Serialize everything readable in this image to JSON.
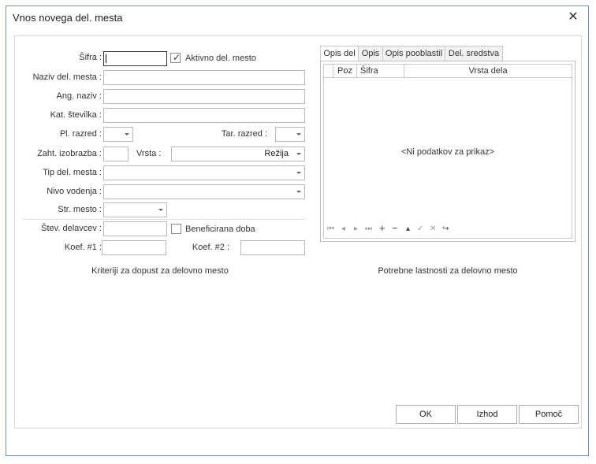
{
  "window": {
    "title": "Vnos novega del. mesta"
  },
  "form": {
    "sifra_label": "Šifra :",
    "aktivno_label": "Aktivno del. mesto",
    "aktivno_checked": true,
    "naziv_label": "Naziv del. mesta :",
    "ang_naziv_label": "Ang. naziv :",
    "kat_stevilka_label": "Kat. številka :",
    "pl_razred_label": "Pl. razred :",
    "tar_razred_label": "Tar. razred :",
    "zaht_izobrazba_label": "Zaht. izobrazba :",
    "vrsta_label": "Vrsta :",
    "vrsta_value": "Režija",
    "tip_label": "Tip del. mesta :",
    "nivo_label": "Nivo vodenja :",
    "str_mesto_label": "Str. mesto :",
    "stev_delavcev_label": "Štev. delavcev :",
    "beneficirana_label": "Beneficirana doba",
    "beneficirana_checked": false,
    "koef1_label": "Koef. #1 :",
    "koef2_label": "Koef. #2 :"
  },
  "captions": {
    "left": "Kriteriji za dopust za delovno mesto",
    "right": "Potrebne lastnosti za delovno mesto"
  },
  "tabs": [
    {
      "label": "Opis del",
      "active": true
    },
    {
      "label": "Opis"
    },
    {
      "label": "Opis pooblastil"
    },
    {
      "label": "Del. sredstva"
    }
  ],
  "grid": {
    "columns": [
      "Poz",
      "Šifra",
      "Vrsta dela"
    ],
    "empty_text": "<Ni podatkov za prikaz>"
  },
  "navigator": [
    "first-icon",
    "prev-icon",
    "next-icon",
    "last-icon",
    "add-icon",
    "delete-icon",
    "up-icon",
    "confirm-icon",
    "cancel-icon",
    "refresh-icon"
  ],
  "buttons": {
    "ok": "OK",
    "izhod": "Izhod",
    "pomoc": "Pomoč"
  }
}
